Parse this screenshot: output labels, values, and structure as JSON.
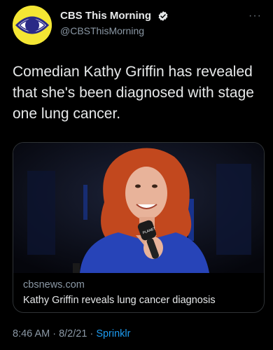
{
  "account": {
    "display_name": "CBS This Morning",
    "handle": "@CBSThisMorning",
    "avatar_bg": "#f4e634",
    "verified_color": "#e7e9ea"
  },
  "tweet": {
    "text": "Comedian Kathy Griffin has revealed that she's been diagnosed with stage one lung cancer.",
    "more_icon": "more-options-icon",
    "more_label": "···"
  },
  "card": {
    "domain": "cbsnews.com",
    "title": "Kathy Griffin reveals lung cancer diagnosis",
    "mic_label": "PLANET"
  },
  "meta": {
    "time": "8:46 AM",
    "separator": " · ",
    "date": "8/2/21",
    "source": "Sprinklr",
    "source_color": "#1d9bf0"
  }
}
